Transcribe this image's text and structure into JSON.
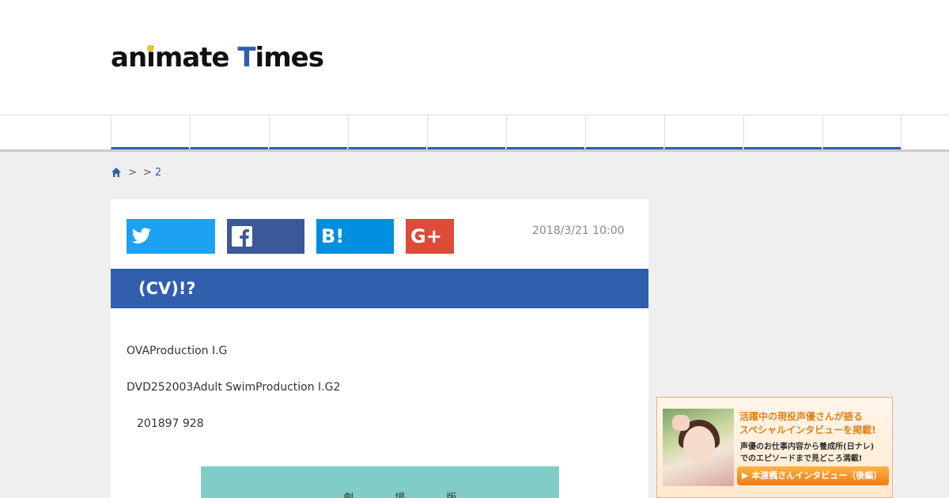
{
  "header": {
    "logo": {
      "part1": "an",
      "i_letter": "i",
      "part2": "mate ",
      "t_letter": "T",
      "part3": "imes"
    }
  },
  "nav": {
    "items": [
      "",
      "",
      "",
      "",
      "",
      "",
      "",
      "",
      "",
      ""
    ]
  },
  "breadcrumb": {
    "sep1": ">",
    "sep2": ">",
    "current": "2"
  },
  "article": {
    "date": "2018/3/21 10:00",
    "title": "(CV)!?",
    "paragraphs": [
      "OVAProduction I.G",
      "DVD252003Adult SwimProduction I.G2",
      "201897 928"
    ],
    "figure_text": "劇 場 版"
  },
  "share": {
    "twitter_icon": "twitter-icon",
    "facebook_icon": "facebook-icon",
    "hatena_label": "B!",
    "gplus_label": "G+"
  },
  "ad": {
    "headline1": "活躍中の現役声優さんが語る",
    "headline2": "スペシャルインタビューを掲載!",
    "sub1": "声優のお仕事内容から養成所(日ナレ)",
    "sub2": "でのエピソードまで見どころ満載!",
    "button": "▶ 本渡楓さんインタビュー（後編）"
  },
  "colors": {
    "brand_blue": "#2f5fad",
    "twitter": "#1da1f2",
    "facebook": "#3b5998",
    "hatena": "#008fde",
    "gplus": "#dd4b39",
    "figure_teal": "#80ccc6",
    "ad_orange": "#e0821c"
  }
}
